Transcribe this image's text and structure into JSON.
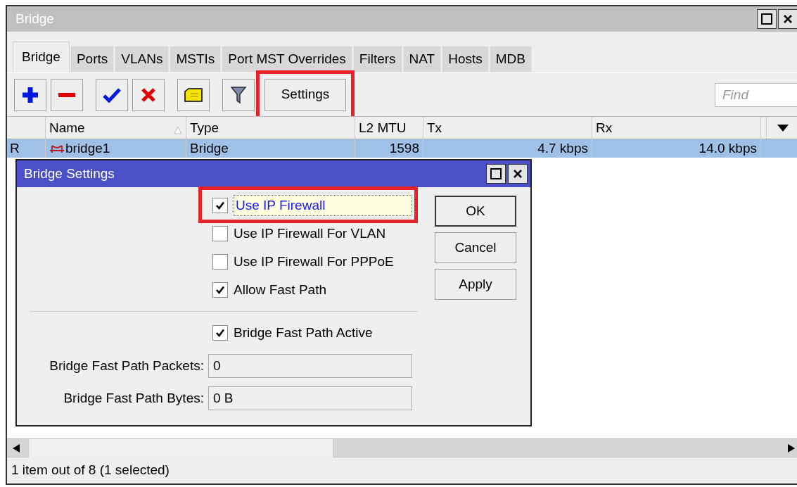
{
  "window": {
    "title": "Bridge"
  },
  "tabs": [
    {
      "label": "Bridge",
      "selected": true
    },
    {
      "label": "Ports",
      "selected": false
    },
    {
      "label": "VLANs",
      "selected": false
    },
    {
      "label": "MSTIs",
      "selected": false
    },
    {
      "label": "Port MST Overrides",
      "selected": false
    },
    {
      "label": "Filters",
      "selected": false
    },
    {
      "label": "NAT",
      "selected": false
    },
    {
      "label": "Hosts",
      "selected": false
    },
    {
      "label": "MDB",
      "selected": false
    }
  ],
  "toolbar": {
    "settings_button": {
      "label": "Settings",
      "highlighted": true
    },
    "find": {
      "placeholder": "Find"
    }
  },
  "table": {
    "columns": [
      {
        "label": "Name",
        "sorted": true
      },
      {
        "label": "Type",
        "sorted": false
      },
      {
        "label": "L2 MTU",
        "sorted": false
      },
      {
        "label": "Tx",
        "sorted": false
      },
      {
        "label": "Rx",
        "sorted": false
      }
    ],
    "rows": [
      {
        "flag": "R",
        "selected": true,
        "cells": [
          "bridge1",
          "Bridge",
          "1598",
          "4.7 kbps",
          "14.0 kbps"
        ]
      }
    ]
  },
  "dialog": {
    "title": "Bridge Settings",
    "options": [
      {
        "label": "Use IP Firewall",
        "checked": true,
        "focused": true,
        "highlighted": true
      },
      {
        "label": "Use IP Firewall For VLAN",
        "checked": false,
        "focused": false,
        "highlighted": false
      },
      {
        "label": "Use IP Firewall For PPPoE",
        "checked": false,
        "focused": false,
        "highlighted": false
      },
      {
        "label": "Allow Fast Path",
        "checked": true,
        "focused": false,
        "highlighted": false
      }
    ],
    "status": [
      {
        "label": "Bridge Fast Path Active",
        "checked": true,
        "focused": false,
        "highlighted": false
      }
    ],
    "fields": [
      {
        "label": "Bridge Fast Path Packets:",
        "value": "0"
      },
      {
        "label": "Bridge Fast Path Bytes:",
        "value": "0 B"
      }
    ],
    "buttons": [
      "OK",
      "Cancel",
      "Apply"
    ]
  },
  "status_bar": "1 item out of 8 (1 selected)"
}
